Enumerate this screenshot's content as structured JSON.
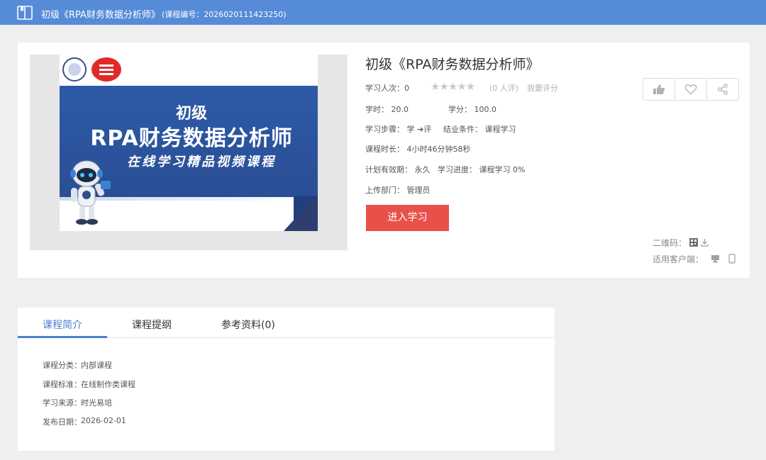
{
  "header": {
    "title": "初级《RPA财务数据分析师》",
    "code": "(课程编号：2026020111423250)"
  },
  "cover": {
    "line1": "初级",
    "line2": "RPA财务数据分析师",
    "line3": "在线学习精品视频课程"
  },
  "course": {
    "title": "初级《RPA财务数据分析师》",
    "learners_label": "学习人次：0",
    "stars": "★★★★★",
    "rating_count": "(0 人评)",
    "rate_link": "我要评分",
    "hours": "学时：  20.0",
    "credits": "学分：  100.0",
    "steps": "学习步骤：  学 ➔评",
    "completion": "结业条件：  课程学习",
    "duration": "课程时长：   4小时46分钟58秒",
    "validity": "计划有效期：  永久",
    "progress": "学习进度：  课程学习   0%",
    "department": "上传部门：   管理员"
  },
  "actions": {
    "like_icon": "thumbs-up-icon",
    "favorite_icon": "heart-icon",
    "share_icon": "share-icon"
  },
  "enter_button": "进入学习",
  "qr_label": "二维码：",
  "client_label": "适用客户端：",
  "tabs": [
    {
      "label": "课程简介",
      "active": true
    },
    {
      "label": "课程提纲",
      "active": false
    },
    {
      "label": "参考资料(0)",
      "active": false
    }
  ],
  "details": [
    {
      "label": "课程分类：",
      "value": "内部课程"
    },
    {
      "label": "课程标准：",
      "value": "在线制作类课程"
    },
    {
      "label": "学习来源：",
      "value": "时光易培"
    },
    {
      "label": "发布日期：",
      "value": "2026-02-01"
    }
  ],
  "colors": {
    "header_bg": "#568bd8",
    "accent": "#4a7fd0",
    "enter_button": "#e8514a"
  }
}
